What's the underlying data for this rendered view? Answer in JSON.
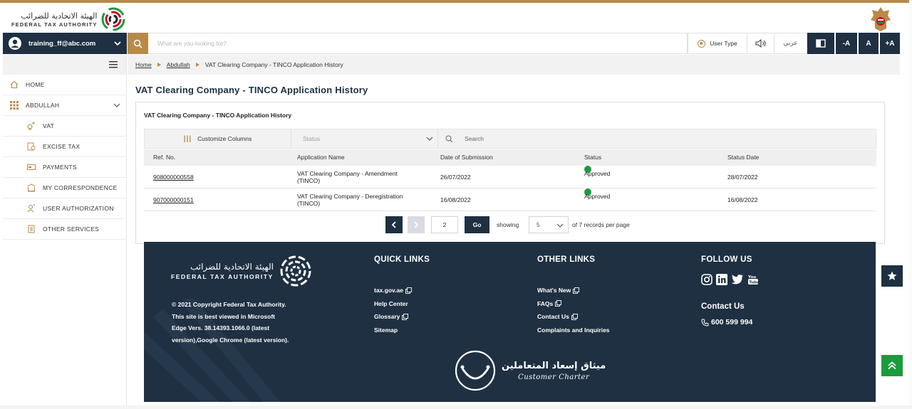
{
  "brand": {
    "logo_ar": "الهيئة الاتحادية للضرائب",
    "logo_en": "FEDERAL TAX AUTHORITY"
  },
  "header": {
    "user_email": "training_ff@abc.com",
    "search_placeholder": "What are you looking for?",
    "user_type_label": "User Type",
    "language_label": "عربي",
    "font_decrease": "-A",
    "font_normal": "A",
    "font_increase": "+A"
  },
  "sidebar": {
    "items": [
      {
        "label": "HOME",
        "icon": "home-icon"
      },
      {
        "label": "ABDULLAH",
        "icon": "grid-icon"
      },
      {
        "label": "VAT",
        "icon": "vat-icon"
      },
      {
        "label": "EXCISE TAX",
        "icon": "excise-icon"
      },
      {
        "label": "PAYMENTS",
        "icon": "payments-icon"
      },
      {
        "label": "MY CORRESPONDENCE",
        "icon": "correspondence-icon"
      },
      {
        "label": "USER AUTHORIZATION",
        "icon": "user-auth-icon"
      },
      {
        "label": "OTHER SERVICES",
        "icon": "other-services-icon"
      }
    ]
  },
  "breadcrumb": {
    "items": [
      "Home",
      "Abdullah",
      "VAT Clearing Company - TINCO Application History"
    ]
  },
  "page": {
    "title": "VAT Clearing Company - TINCO Application History",
    "card_title": "VAT Clearing Company - TINCO Application History"
  },
  "table": {
    "customize_label": "Customize Columns",
    "status_placeholder": "Status",
    "search_placeholder": "Search",
    "columns": [
      "Ref. No.",
      "Application Name",
      "Date of Submission",
      "Status",
      "Status Date"
    ],
    "rows": [
      {
        "ref": "908000000558",
        "name_line1": "VAT Clearing Company - Amendment",
        "name_line2": "(TINCO)",
        "submitted": "26/07/2022",
        "status": "Approved",
        "status_date": "28/07/2022"
      },
      {
        "ref": "907000000151",
        "name_line1": "VAT Clearing Company - Deregistration",
        "name_line2": "(TINCO)",
        "submitted": "16/08/2022",
        "status": "Approved",
        "status_date": "16/08/2022"
      }
    ],
    "status_color": "#1a9b3d"
  },
  "pagination": {
    "current_page": "2",
    "go_label": "Go",
    "showing_label": "showing",
    "per_page": "5",
    "records_text": "of 7 records per page"
  },
  "footer": {
    "logo_ar": "الهيئة الاتحادية للضرائب",
    "logo_en": "FEDERAL TAX AUTHORITY",
    "copyright_lines": [
      "© 2021 Copyright Federal Tax Authority.",
      "This site is best viewed in Microsoft",
      "Edge Vers. 38.14393.1066.0 (latest",
      "version),Google Chrome (latest version)."
    ],
    "quick_links_title": "QUICK LINKS",
    "quick_links": [
      "tax.gov.ae",
      "Help Center",
      "Glossary",
      "Sitemap"
    ],
    "other_links_title": "OTHER LINKS",
    "other_links": [
      "What's New",
      "FAQs",
      "Contact Us",
      "Complaints and Inquiries"
    ],
    "follow_title": "FOLLOW US",
    "contact_title": "Contact Us",
    "phone": "600 599 994",
    "charter_ar": "ميثاق إسعاد المتعاملين",
    "charter_en": "Customer Charter"
  },
  "colors": {
    "navy": "#1e3042",
    "gold": "#b78a4a",
    "green": "#1a9b3d"
  }
}
